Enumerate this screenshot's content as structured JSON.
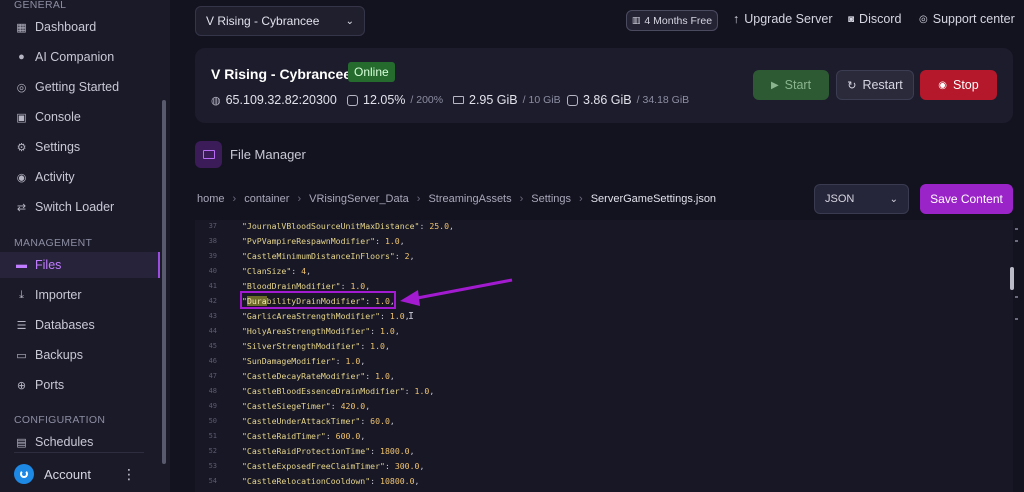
{
  "sidebar": {
    "section_general": "GENERAL",
    "section_management": "MANAGEMENT",
    "section_configuration": "CONFIGURATION",
    "general_items": [
      {
        "label": "Dashboard",
        "icon": "grid-icon"
      },
      {
        "label": "AI Companion",
        "icon": "chat-icon"
      },
      {
        "label": "Getting Started",
        "icon": "life-ring-icon"
      },
      {
        "label": "Console",
        "icon": "terminal-icon"
      },
      {
        "label": "Settings",
        "icon": "gear-icon"
      },
      {
        "label": "Activity",
        "icon": "eye-icon"
      },
      {
        "label": "Switch Loader",
        "icon": "swap-icon"
      }
    ],
    "management_items": [
      {
        "label": "Files",
        "icon": "folder-icon",
        "active": true
      },
      {
        "label": "Importer",
        "icon": "download-icon"
      },
      {
        "label": "Databases",
        "icon": "database-icon"
      },
      {
        "label": "Backups",
        "icon": "archive-icon"
      },
      {
        "label": "Ports",
        "icon": "network-icon"
      }
    ],
    "configuration_items": [
      {
        "label": "Schedules",
        "icon": "calendar-icon"
      }
    ],
    "account_label": "Account"
  },
  "topbar": {
    "server_select": "V Rising - Cybrancee",
    "months_free": "4 Months Free",
    "upgrade": "Upgrade Server",
    "discord": "Discord",
    "support": "Support center"
  },
  "server": {
    "name": "V Rising - Cybrancee",
    "status": "Online",
    "ip": "65.109.32.82:20300",
    "cpu": "12.05%",
    "cpu_max": "/ 200%",
    "ram": "2.95 GiB",
    "ram_max": "/ 10 GiB",
    "disk": "3.86 GiB",
    "disk_max": "/ 34.18 GiB",
    "start_label": "Start",
    "restart_label": "Restart",
    "stop_label": "Stop"
  },
  "file_manager": {
    "title": "File Manager",
    "breadcrumb": [
      "home",
      "container",
      "VRisingServer_Data",
      "StreamingAssets",
      "Settings"
    ],
    "current_file": "ServerGameSettings.json",
    "format": "JSON",
    "save_label": "Save Content"
  },
  "editor": {
    "lines": [
      {
        "n": "37",
        "key": "\"JournalVBloodSourceUnitMaxDistance\"",
        "val": "25.0"
      },
      {
        "n": "38",
        "key": "\"PvPVampireRespawnModifier\"",
        "val": "1.0"
      },
      {
        "n": "39",
        "key": "\"CastleMinimumDistanceInFloors\"",
        "val": "2"
      },
      {
        "n": "40",
        "key": "\"ClanSize\"",
        "val": "4"
      },
      {
        "n": "41",
        "key": "\"BloodDrainModifier\"",
        "val": "1.0"
      },
      {
        "n": "42",
        "key": "\"DurabilityDrainModifier\"",
        "val": "1.0"
      },
      {
        "n": "43",
        "key": "\"GarlicAreaStrengthModifier\"",
        "val": "1.0"
      },
      {
        "n": "44",
        "key": "\"HolyAreaStrengthModifier\"",
        "val": "1.0"
      },
      {
        "n": "45",
        "key": "\"SilverStrengthModifier\"",
        "val": "1.0"
      },
      {
        "n": "46",
        "key": "\"SunDamageModifier\"",
        "val": "1.0"
      },
      {
        "n": "47",
        "key": "\"CastleDecayRateModifier\"",
        "val": "1.0"
      },
      {
        "n": "48",
        "key": "\"CastleBloodEssenceDrainModifier\"",
        "val": "1.0"
      },
      {
        "n": "49",
        "key": "\"CastleSiegeTimer\"",
        "val": "420.0"
      },
      {
        "n": "50",
        "key": "\"CastleUnderAttackTimer\"",
        "val": "60.0"
      },
      {
        "n": "51",
        "key": "\"CastleRaidTimer\"",
        "val": "600.0"
      },
      {
        "n": "52",
        "key": "\"CastleRaidProtectionTime\"",
        "val": "1800.0"
      },
      {
        "n": "53",
        "key": "\"CastleExposedFreeClaimTimer\"",
        "val": "300.0"
      },
      {
        "n": "54",
        "key": "\"CastleRelocationCooldown\"",
        "val": "10800.0"
      }
    ],
    "highlight_text": "Dura",
    "highlight_line": "42"
  },
  "colors": {
    "accent": "#9b24c9",
    "online": "#256b2e",
    "stop": "#b5182a",
    "annotation": "#a21bd0"
  }
}
